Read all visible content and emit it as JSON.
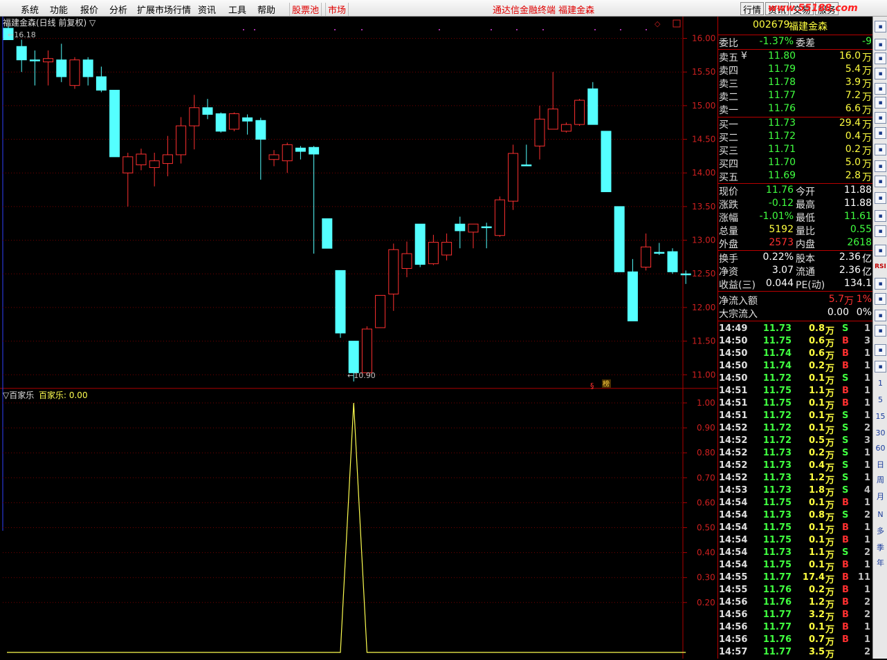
{
  "menu": {
    "items": [
      "系统",
      "功能",
      "报价",
      "分析",
      "扩展市场行情",
      "资讯",
      "工具",
      "帮助"
    ],
    "red_items": [
      "股票池",
      "市场"
    ],
    "title": "通达信金融终端  福建金森",
    "right_buttons": [
      "行情",
      "资讯",
      "交易",
      "服务"
    ],
    "watermark": "www.55188.com"
  },
  "kline": {
    "header": "福建金森(日线 前复权) ▽",
    "max_label": "16.18",
    "min_label": "10.90",
    "yticks": [
      "16.00",
      "15.50",
      "15.00",
      "14.50",
      "14.00",
      "13.50",
      "13.00",
      "12.50",
      "12.00",
      "11.50",
      "11.00"
    ],
    "candles": [
      [
        16.15,
        15.98,
        16.18,
        15.98
      ],
      [
        15.88,
        15.68,
        15.98,
        15.5
      ],
      [
        15.68,
        15.68,
        15.82,
        15.3
      ],
      [
        15.65,
        15.7,
        15.82,
        15.3
      ],
      [
        15.68,
        15.43,
        15.92,
        15.35
      ],
      [
        15.3,
        15.68,
        15.72,
        15.25
      ],
      [
        15.68,
        15.43,
        15.72,
        15.3
      ],
      [
        15.43,
        15.23,
        15.58,
        15.2
      ],
      [
        15.23,
        14.24,
        15.23,
        14.24
      ],
      [
        14.0,
        14.24,
        14.3,
        13.5
      ],
      [
        14.12,
        14.28,
        14.36,
        14.04
      ],
      [
        14.08,
        14.18,
        14.3,
        13.8
      ],
      [
        14.14,
        14.27,
        14.55,
        13.95
      ],
      [
        14.27,
        14.7,
        14.83,
        14.14
      ],
      [
        14.7,
        14.97,
        15.16,
        14.35
      ],
      [
        14.97,
        14.87,
        15.1,
        14.8
      ],
      [
        14.88,
        14.62,
        14.9,
        14.6
      ],
      [
        14.65,
        14.88,
        14.9,
        14.62
      ],
      [
        14.82,
        14.77,
        14.87,
        14.57
      ],
      [
        14.78,
        14.5,
        14.82,
        13.9
      ],
      [
        14.2,
        14.27,
        14.34,
        14.1
      ],
      [
        14.18,
        14.42,
        14.45,
        14.0
      ],
      [
        14.37,
        14.32,
        14.4,
        14.2
      ],
      [
        14.38,
        14.28,
        14.4,
        12.8
      ],
      [
        13.32,
        12.88,
        13.32,
        12.88
      ],
      [
        12.55,
        11.62,
        12.55,
        11.55
      ],
      [
        11.5,
        11.03,
        11.5,
        10.9
      ],
      [
        11.03,
        11.68,
        11.72,
        11.0
      ],
      [
        11.7,
        12.18,
        12.18,
        11.7
      ],
      [
        12.2,
        12.86,
        12.95,
        11.95
      ],
      [
        12.58,
        12.8,
        12.98,
        12.45
      ],
      [
        13.24,
        12.64,
        13.24,
        12.6
      ],
      [
        12.65,
        12.97,
        13.08,
        12.63
      ],
      [
        12.78,
        12.97,
        13.1,
        12.7
      ],
      [
        13.24,
        13.14,
        13.35,
        12.88
      ],
      [
        13.12,
        13.24,
        13.24,
        12.88
      ],
      [
        13.2,
        13.2,
        13.26,
        12.88
      ],
      [
        13.07,
        13.6,
        13.65,
        13.05
      ],
      [
        13.58,
        14.29,
        14.42,
        13.45
      ],
      [
        14.12,
        14.12,
        14.42,
        14.1
      ],
      [
        14.4,
        14.8,
        15.0,
        14.2
      ],
      [
        14.65,
        14.95,
        15.5,
        14.65
      ],
      [
        14.62,
        14.72,
        14.75,
        14.6
      ],
      [
        14.72,
        15.08,
        15.1,
        14.7
      ],
      [
        15.25,
        14.72,
        15.35,
        14.72
      ],
      [
        14.62,
        13.72,
        14.62,
        13.72
      ],
      [
        13.5,
        12.53,
        13.5,
        12.53
      ],
      [
        12.53,
        11.8,
        12.72,
        11.8
      ],
      [
        12.6,
        12.9,
        13.1,
        12.55
      ],
      [
        12.82,
        12.82,
        12.96,
        12.78
      ],
      [
        12.83,
        12.53,
        12.88,
        12.5
      ],
      [
        12.5,
        12.5,
        12.55,
        12.35
      ]
    ],
    "markers": [
      "§",
      "榜"
    ],
    "marker_color": "#ff3030"
  },
  "indicator": {
    "name": "▽百家乐",
    "label": "百家乐: 0.00",
    "yticks": [
      "1.00",
      "0.90",
      "0.80",
      "0.70",
      "0.60",
      "0.50",
      "0.40",
      "0.30",
      "0.20"
    ],
    "values": [
      0,
      0,
      0,
      0,
      0,
      0,
      0,
      0,
      0,
      0,
      0,
      0,
      0,
      0,
      0,
      0,
      0,
      0,
      0,
      0,
      0,
      0,
      0,
      0,
      0,
      0,
      1,
      0,
      0,
      0,
      0,
      0,
      0,
      0,
      0,
      0,
      0,
      0,
      0,
      0,
      0,
      0,
      0,
      0,
      0,
      0,
      0,
      0,
      0,
      0,
      0,
      0
    ]
  },
  "quote": {
    "code": "002679",
    "name": "福建金森",
    "weibi": {
      "label": "委比",
      "value": "-1.37%"
    },
    "weicha": {
      "label": "委差",
      "value": "-9"
    },
    "sell": [
      {
        "label": "卖五",
        "price": "11.80",
        "vol": "16.0",
        "unit": "万",
        "mark": "¥"
      },
      {
        "label": "卖四",
        "price": "11.79",
        "vol": "5.4",
        "unit": "万"
      },
      {
        "label": "卖三",
        "price": "11.78",
        "vol": "3.9",
        "unit": "万"
      },
      {
        "label": "卖二",
        "price": "11.77",
        "vol": "7.2",
        "unit": "万"
      },
      {
        "label": "卖一",
        "price": "11.76",
        "vol": "6.6",
        "unit": "万"
      }
    ],
    "buy": [
      {
        "label": "买一",
        "price": "11.73",
        "vol": "29.4",
        "unit": "万"
      },
      {
        "label": "买二",
        "price": "11.72",
        "vol": "0.4",
        "unit": "万"
      },
      {
        "label": "买三",
        "price": "11.71",
        "vol": "0.2",
        "unit": "万"
      },
      {
        "label": "买四",
        "price": "11.70",
        "vol": "5.0",
        "unit": "万"
      },
      {
        "label": "买五",
        "price": "11.69",
        "vol": "2.8",
        "unit": "万"
      }
    ],
    "stats": [
      [
        {
          "l": "现价",
          "v": "11.76",
          "c": "#40ff40"
        },
        {
          "l": "今开",
          "v": "11.88",
          "c": "#ffffff"
        }
      ],
      [
        {
          "l": "涨跌",
          "v": "-0.12",
          "c": "#40ff40"
        },
        {
          "l": "最高",
          "v": "11.88",
          "c": "#ffffff"
        }
      ],
      [
        {
          "l": "涨幅",
          "v": "-1.01%",
          "c": "#40ff40"
        },
        {
          "l": "最低",
          "v": "11.61",
          "c": "#40ff40"
        }
      ],
      [
        {
          "l": "总量",
          "v": "5192",
          "c": "#ffff40"
        },
        {
          "l": "量比",
          "v": "0.55",
          "c": "#40ff40"
        }
      ],
      [
        {
          "l": "外盘",
          "v": "2573",
          "c": "#ff3030"
        },
        {
          "l": "内盘",
          "v": "2618",
          "c": "#40ff40"
        }
      ]
    ],
    "fund": [
      [
        {
          "l": "换手",
          "v": "0.22%"
        },
        {
          "l": "股本",
          "v": "2.36",
          "u": "亿"
        }
      ],
      [
        {
          "l": "净资",
          "v": "3.07"
        },
        {
          "l": "流通",
          "v": "2.36",
          "u": "亿"
        }
      ],
      [
        {
          "l": "收益(三)",
          "v": "0.044"
        },
        {
          "l": "PE(动)",
          "v": "134.1"
        }
      ]
    ],
    "flow": [
      {
        "l": "净流入额",
        "v": "5.7",
        "u": "万",
        "p": "1%",
        "c": "#ff3030"
      },
      {
        "l": "大宗流入",
        "v": "0.00",
        "u": "",
        "p": "0%",
        "c": "#ffffff"
      }
    ]
  },
  "ticks": [
    [
      "14:49",
      "11.73",
      "0.8",
      "S",
      "1"
    ],
    [
      "14:50",
      "11.75",
      "0.6",
      "B",
      "3"
    ],
    [
      "14:50",
      "11.74",
      "0.6",
      "B",
      "1"
    ],
    [
      "14:50",
      "11.74",
      "0.2",
      "B",
      "1"
    ],
    [
      "14:50",
      "11.72",
      "0.1",
      "S",
      "1"
    ],
    [
      "14:51",
      "11.75",
      "1.1",
      "B",
      "1"
    ],
    [
      "14:51",
      "11.75",
      "0.1",
      "B",
      "1"
    ],
    [
      "14:51",
      "11.72",
      "0.1",
      "S",
      "1"
    ],
    [
      "14:52",
      "11.72",
      "0.1",
      "S",
      "2"
    ],
    [
      "14:52",
      "11.72",
      "0.5",
      "S",
      "3"
    ],
    [
      "14:52",
      "11.73",
      "0.2",
      "S",
      "1"
    ],
    [
      "14:52",
      "11.73",
      "0.4",
      "S",
      "1"
    ],
    [
      "14:52",
      "11.73",
      "1.2",
      "S",
      "1"
    ],
    [
      "14:53",
      "11.73",
      "1.8",
      "S",
      "4"
    ],
    [
      "14:54",
      "11.75",
      "0.1",
      "B",
      "1"
    ],
    [
      "14:54",
      "11.73",
      "0.8",
      "S",
      "2"
    ],
    [
      "14:54",
      "11.75",
      "0.1",
      "B",
      "1"
    ],
    [
      "14:54",
      "11.75",
      "0.1",
      "B",
      "1"
    ],
    [
      "14:54",
      "11.73",
      "1.1",
      "S",
      "2"
    ],
    [
      "14:54",
      "11.75",
      "0.1",
      "B",
      "1"
    ],
    [
      "14:55",
      "11.77",
      "17.4",
      "B",
      "11"
    ],
    [
      "14:55",
      "11.76",
      "0.2",
      "B",
      "1"
    ],
    [
      "14:56",
      "11.76",
      "1.2",
      "B",
      "2"
    ],
    [
      "14:56",
      "11.77",
      "3.2",
      "B",
      "2"
    ],
    [
      "14:56",
      "11.77",
      "0.1",
      "B",
      "1"
    ],
    [
      "14:56",
      "11.76",
      "0.7",
      "B",
      "1"
    ],
    [
      "14:57",
      "11.77",
      "3.5",
      "",
      "2"
    ]
  ],
  "toolbar": {
    "text_items": [
      "RSI",
      "1",
      "5",
      "15",
      "30",
      "60",
      "日",
      "周",
      "月",
      "N",
      "多",
      "季",
      "年"
    ]
  }
}
